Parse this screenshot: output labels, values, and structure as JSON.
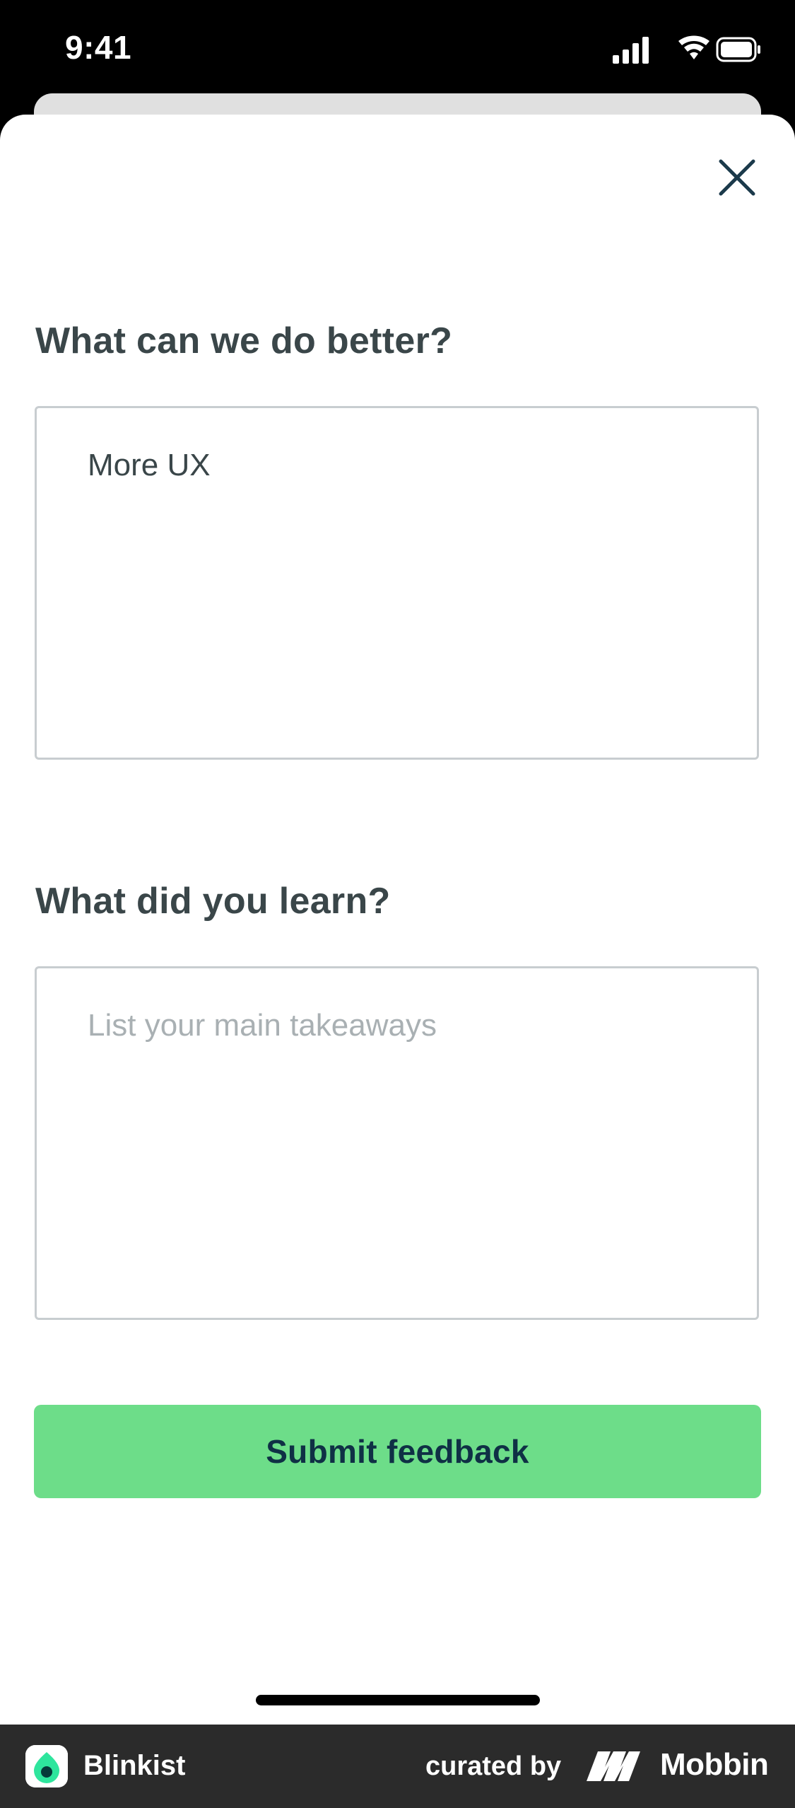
{
  "status_bar": {
    "time": "9:41"
  },
  "form": {
    "question_1": "What can we do better?",
    "answer_1_value": "More UX",
    "question_2": "What did you learn?",
    "answer_2_placeholder": "List your main takeaways",
    "submit_label": "Submit feedback"
  },
  "footer": {
    "app_name": "Blinkist",
    "curated_label": "curated by",
    "brand_name": "Mobbin"
  },
  "colors": {
    "accent_green": "#6ddd89",
    "heading_text": "#3a4649",
    "button_text": "#0f3045",
    "close_icon": "#1b3a4b"
  },
  "icons": {
    "close": "close-icon",
    "signal": "cellular-signal-icon",
    "wifi": "wifi-icon",
    "battery": "battery-icon"
  }
}
